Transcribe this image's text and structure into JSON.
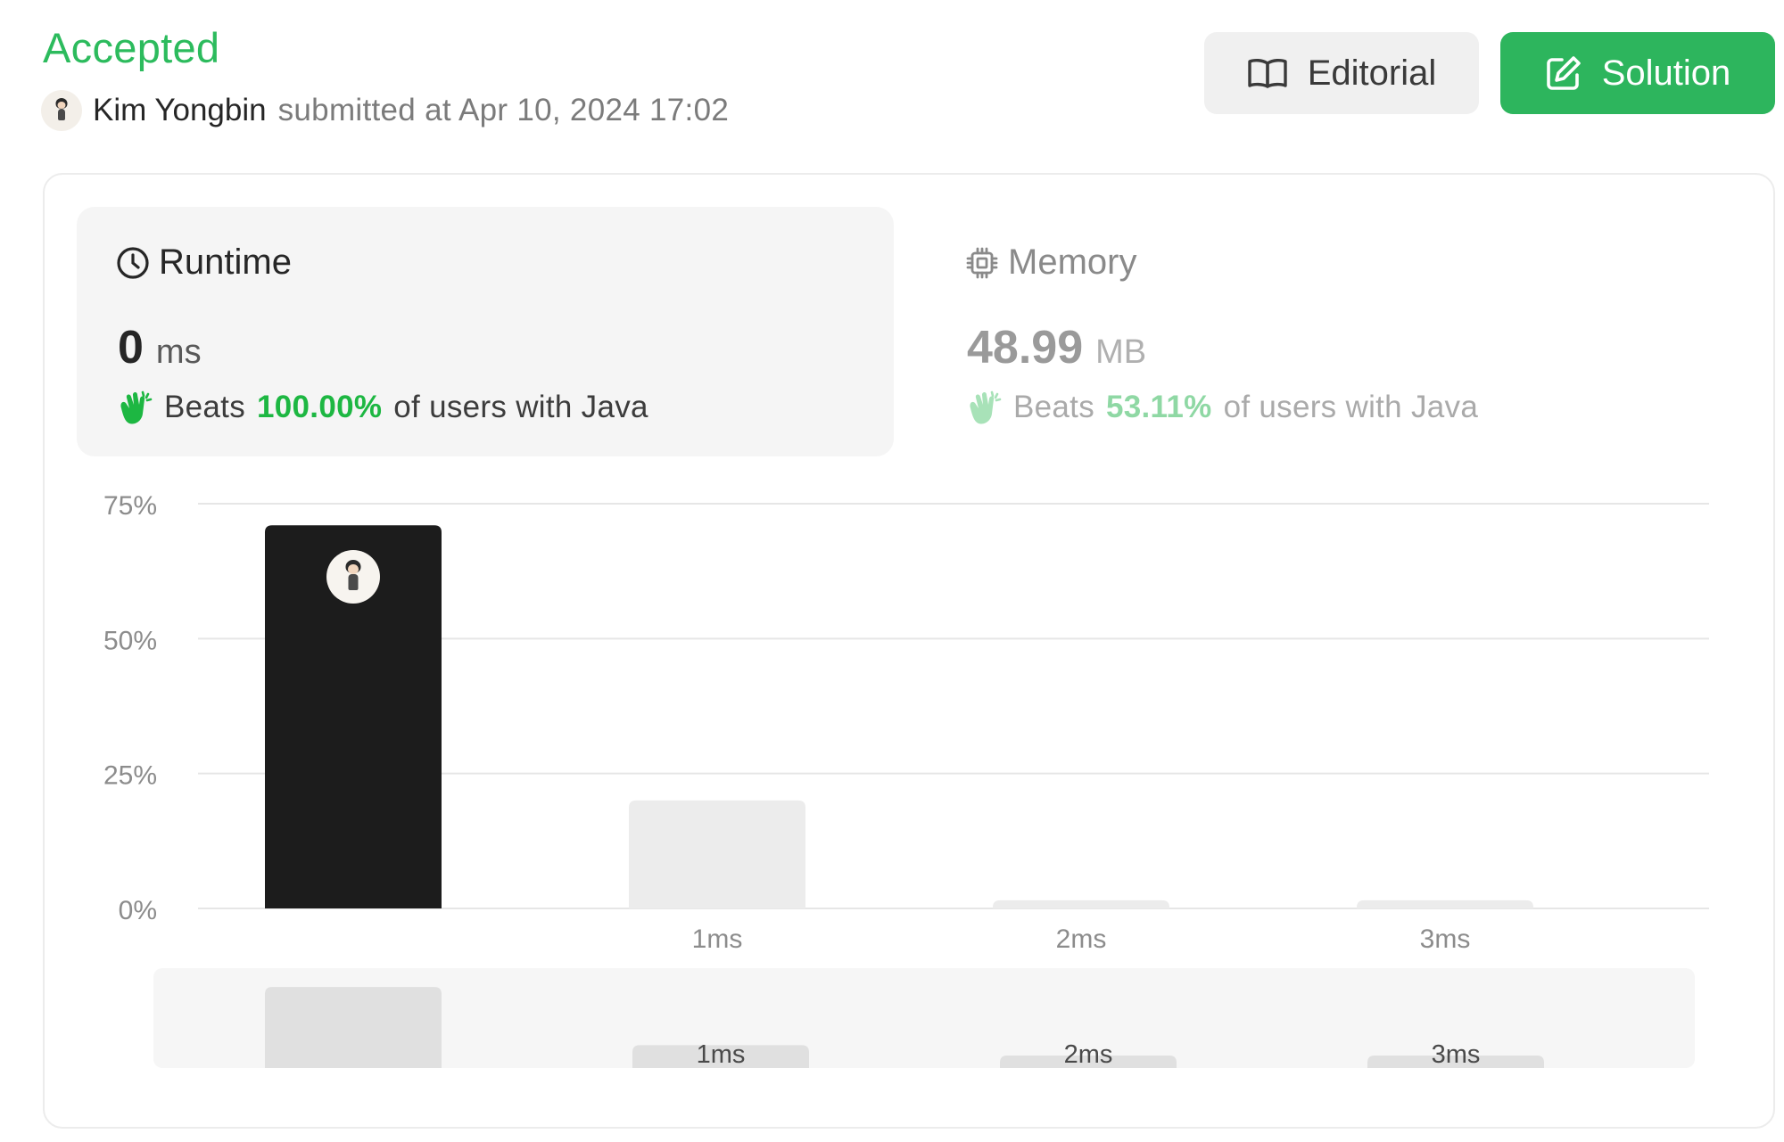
{
  "header": {
    "status": "Accepted",
    "user_name": "Kim Yongbin",
    "submitted_text": "submitted at Apr 10, 2024 17:02",
    "editorial_label": "Editorial",
    "solution_label": "Solution"
  },
  "runtime": {
    "label": "Runtime",
    "value": "0",
    "unit": "ms",
    "beats_prefix": "Beats",
    "beats_pct": "100.00%",
    "beats_suffix": "of users with Java"
  },
  "memory": {
    "label": "Memory",
    "value": "48.99",
    "unit": "MB",
    "beats_prefix": "Beats",
    "beats_pct": "53.11%",
    "beats_suffix": "of users with Java"
  },
  "colors": {
    "accent": "#2cbb5d",
    "selected_bar": "#1c1c1c",
    "bar": "#ececec",
    "overview_bar": "#e0e0e0"
  },
  "chart_data": {
    "type": "bar",
    "categories": [
      "",
      "1ms",
      "2ms",
      "3ms"
    ],
    "values": [
      71,
      20,
      1.5,
      1.5
    ],
    "ylim": [
      0,
      75
    ],
    "yticks": [
      "0%",
      "25%",
      "50%",
      "75%"
    ],
    "ytick_values": [
      0,
      25,
      50,
      75
    ],
    "selected_index": 0,
    "grid": true,
    "overview": {
      "categories": [
        "",
        "1ms",
        "2ms",
        "3ms"
      ],
      "values": [
        71,
        20,
        1.5,
        1.5
      ]
    }
  }
}
